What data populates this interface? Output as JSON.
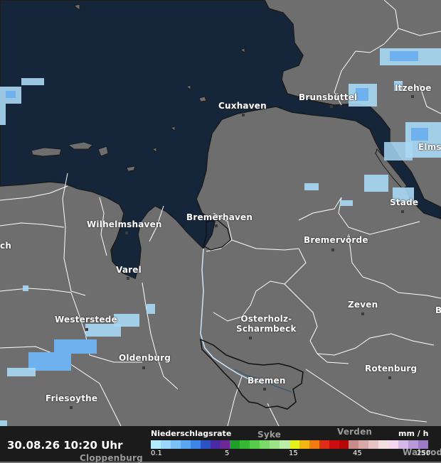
{
  "map": {
    "cities": [
      {
        "name": "Cuxhaven",
        "dot": true
      },
      {
        "name": "Brunsbüttel",
        "dot": true
      },
      {
        "name": "Itzehoe",
        "dot": true
      },
      {
        "name": "Elmsh",
        "dot": false
      },
      {
        "name": "Stade",
        "dot": true
      },
      {
        "name": "Bremerhaven",
        "dot": true
      },
      {
        "name": "Wilhelmshaven",
        "dot": true
      },
      {
        "name": "ch",
        "dot": false
      },
      {
        "name": "Bremervörde",
        "dot": true
      },
      {
        "name": "Varel",
        "dot": true
      },
      {
        "name": "Zeven",
        "dot": true
      },
      {
        "name": "B",
        "dot": false
      },
      {
        "name": "Westerstede",
        "dot": true
      },
      {
        "name": "Osterholz-\nScharmbeck",
        "dot": true
      },
      {
        "name": "Oldenburg",
        "dot": true
      },
      {
        "name": "Rotenburg",
        "dot": true
      },
      {
        "name": "Bremen",
        "dot": true
      },
      {
        "name": "Friesoythe",
        "dot": true
      },
      {
        "name": "Syke",
        "dot": false
      },
      {
        "name": "Verden",
        "dot": false
      },
      {
        "name": "Cloppenburg",
        "dot": false
      },
      {
        "name": "Walsrode",
        "dot": false
      }
    ],
    "colors": {
      "sea": "#15263b",
      "land": "#6e6e6e",
      "border": "#ffffff",
      "rain_light": "#a8d8f5",
      "rain_medium": "#6fb0ee"
    }
  },
  "footer": {
    "datetime": "30.08.26 10:20 Uhr",
    "legend_title": "Niederschlagsrate",
    "legend_unit": "mm / h",
    "ticks": [
      "0.1",
      "5",
      "15",
      "45",
      "250"
    ],
    "scale_colors": [
      "#b4ecff",
      "#9ad8fb",
      "#7dc2f7",
      "#5aa8f2",
      "#3d86e6",
      "#2d52c6",
      "#4a2aa6",
      "#6b2896",
      "#1f9e2a",
      "#36b835",
      "#56cc4a",
      "#7ad968",
      "#9de489",
      "#bdeca8",
      "#e5f01c",
      "#f3b514",
      "#f07b10",
      "#e02a1a",
      "#cc0d0d",
      "#b40808",
      "#c98a8a",
      "#d9a8a8",
      "#e6c4c4",
      "#f2dede",
      "#f3d6f0",
      "#d4b8e6",
      "#b899d8",
      "#9c7ac8"
    ]
  }
}
